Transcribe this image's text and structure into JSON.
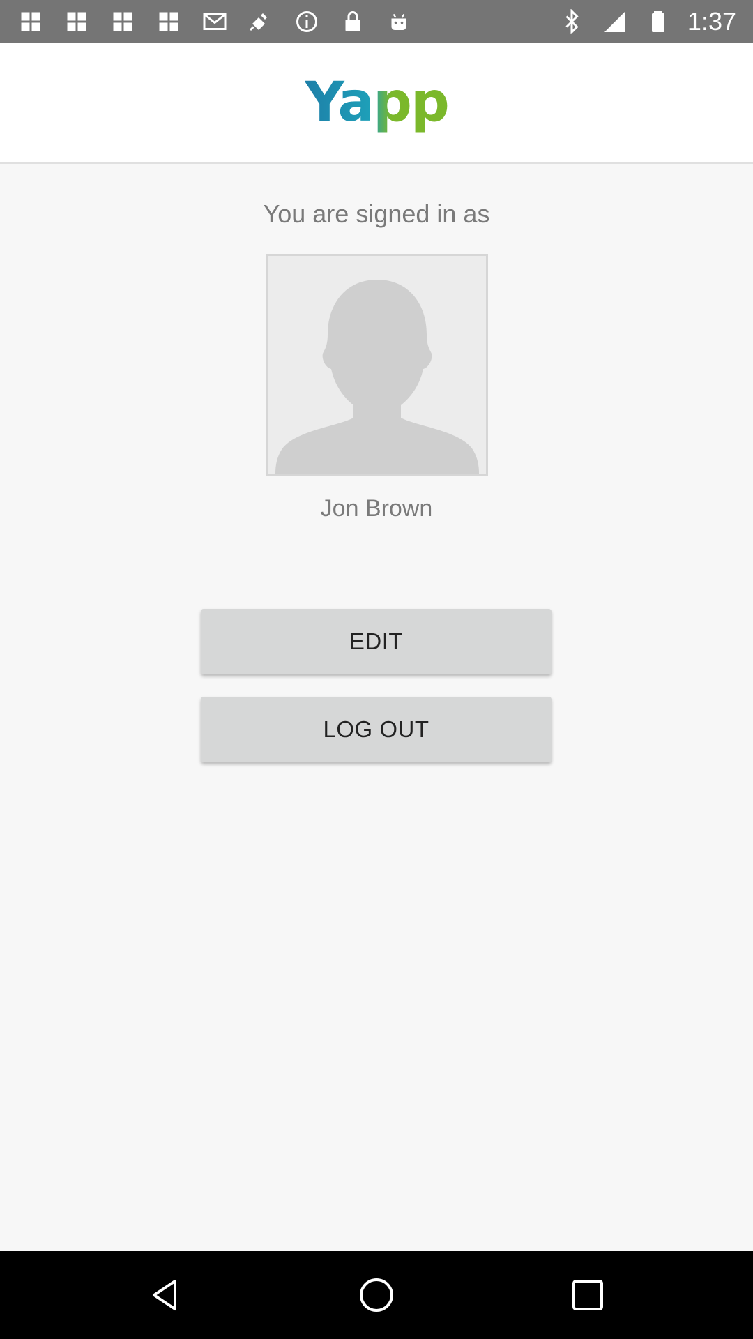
{
  "status_bar": {
    "time": "1:37",
    "left_icons": [
      "app-icon",
      "app-icon",
      "app-icon",
      "app-icon",
      "mail-icon",
      "satellite-fake-gps-icon",
      "info-icon",
      "lock-icon",
      "android-icon"
    ],
    "right_icons": [
      "bluetooth-icon",
      "signal-icon",
      "battery-icon"
    ]
  },
  "header": {
    "logo_text": "Yapp",
    "colors": {
      "blue": "#1e7fa8",
      "green": "#7bb82b"
    }
  },
  "profile": {
    "signed_in_label": "You are signed in as",
    "user_name": "Jon Brown"
  },
  "actions": {
    "edit_label": "EDIT",
    "logout_label": "LOG OUT"
  },
  "nav_bar": {
    "buttons": [
      "back-icon",
      "home-icon",
      "recents-icon"
    ]
  }
}
